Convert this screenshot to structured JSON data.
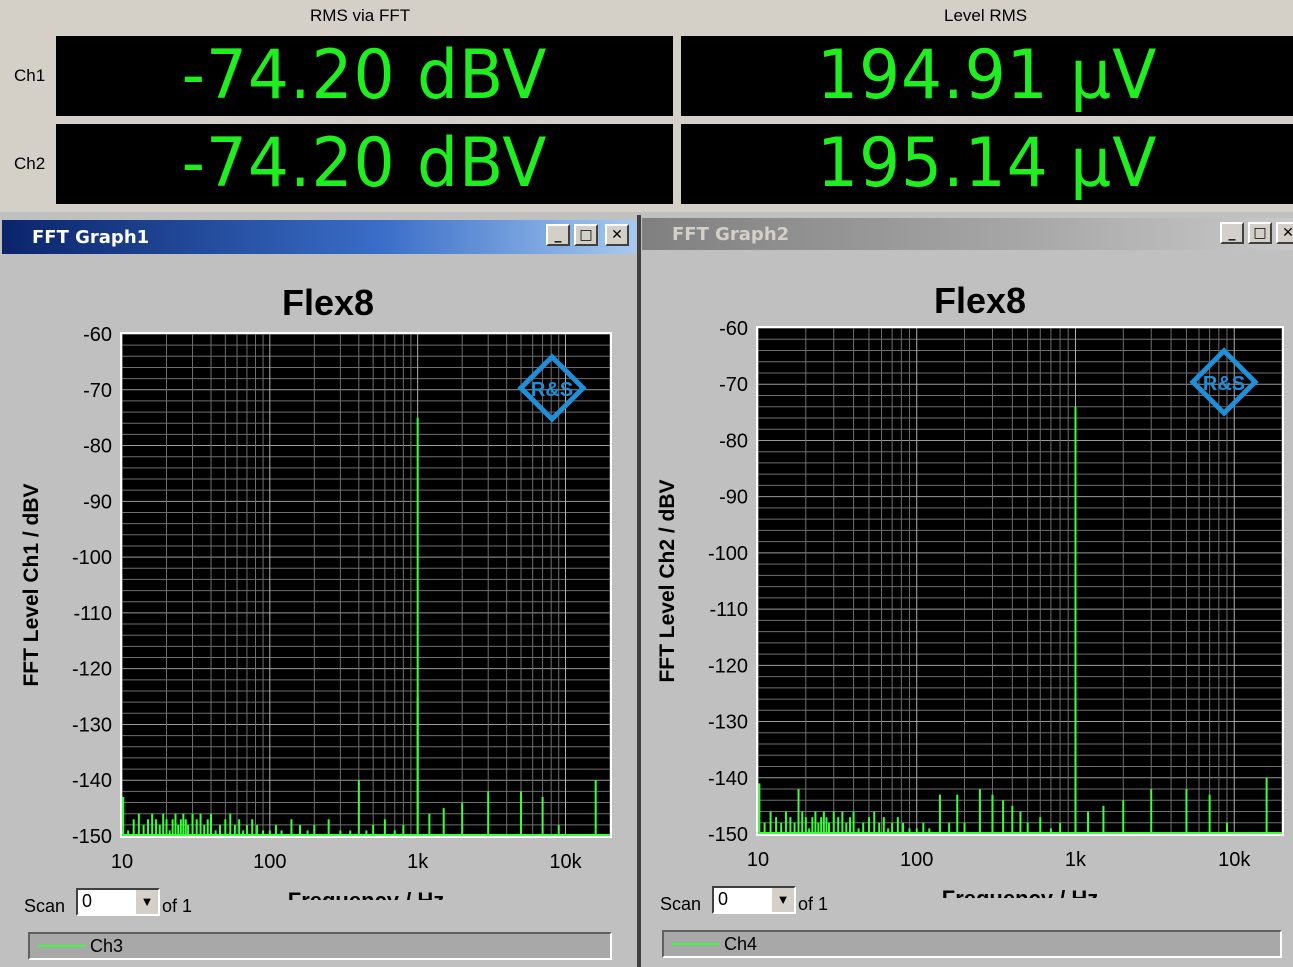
{
  "display": {
    "col1_header": "RMS via FFT",
    "col2_header": "Level RMS",
    "rows": [
      {
        "channel": "Ch1",
        "rms_fft": "-74.20 dBV",
        "level_rms": "194.91 µV"
      },
      {
        "channel": "Ch2",
        "rms_fft": "-74.20 dBV",
        "level_rms": "195.14 µV"
      }
    ],
    "value_color": "#1fef1f"
  },
  "windows": [
    {
      "title": "FFT Graph1",
      "active": true,
      "plot_title": "Flex8",
      "ylabel": "FFT Level Ch1 / dBV",
      "xlabel": "Frequency / Hz",
      "scan_label": "Scan",
      "scan_value": "0",
      "scan_of": "of 1",
      "legend": "Ch3",
      "logo": "R&S"
    },
    {
      "title": "FFT Graph2",
      "active": false,
      "plot_title": "Flex8",
      "ylabel": "FFT Level Ch2 / dBV",
      "xlabel": "Frequency / Hz",
      "scan_label": "Scan",
      "scan_value": "0",
      "scan_of": "of 1",
      "legend": "Ch4",
      "logo": "R&S"
    }
  ],
  "chart_data": [
    {
      "type": "line",
      "title": "Flex8",
      "xlabel": "Frequency / Hz",
      "ylabel": "FFT Level Ch1 / dBV",
      "x_scale": "log",
      "xlim": [
        10,
        20000
      ],
      "ylim": [
        -150,
        -60
      ],
      "x_ticks": [
        "10",
        "100",
        "1k",
        "10k"
      ],
      "y_ticks": [
        "-60",
        "-70",
        "-80",
        "-90",
        "-100",
        "-110",
        "-120",
        "-130",
        "-140",
        "-150"
      ],
      "grid": true,
      "series": [
        {
          "name": "Ch3",
          "color": "#3cff3c",
          "x": [
            10.2,
            11,
            12,
            13,
            14,
            15,
            16,
            17,
            18,
            19,
            20,
            21,
            22,
            23,
            24,
            25,
            26,
            27,
            28,
            30,
            32,
            34,
            36,
            38,
            40,
            43,
            46,
            50,
            54,
            58,
            62,
            66,
            70,
            76,
            82,
            90,
            100,
            110,
            120,
            140,
            160,
            180,
            200,
            250,
            300,
            350,
            400,
            450,
            500,
            600,
            700,
            800,
            1000,
            1000,
            1000,
            1200,
            1500,
            2000,
            3000,
            5000,
            7000,
            9000,
            16000
          ],
          "y": [
            -143,
            -149,
            -147,
            -146,
            -148,
            -147,
            -146,
            -147,
            -148,
            -146,
            -147,
            -149,
            -147,
            -146,
            -148,
            -147,
            -146,
            -147,
            -148,
            -146,
            -147,
            -146,
            -148,
            -147,
            -146,
            -149,
            -148,
            -147,
            -146,
            -148,
            -147,
            -149,
            -148,
            -147,
            -148,
            -149,
            -149,
            -148,
            -149,
            -147,
            -148,
            -149,
            -148,
            -147,
            -149,
            -149,
            -140,
            -149,
            -148,
            -147,
            -149,
            -148,
            -150,
            -75,
            -125,
            -146,
            -145,
            -144,
            -142,
            -142,
            -143,
            -148,
            -140
          ]
        }
      ]
    },
    {
      "type": "line",
      "title": "Flex8",
      "xlabel": "Frequency / Hz",
      "ylabel": "FFT Level Ch2 / dBV",
      "x_scale": "log",
      "xlim": [
        10,
        20000
      ],
      "ylim": [
        -150,
        -60
      ],
      "x_ticks": [
        "10",
        "100",
        "1k",
        "10k"
      ],
      "y_ticks": [
        "-60",
        "-70",
        "-80",
        "-90",
        "-100",
        "-110",
        "-120",
        "-130",
        "-140",
        "-150"
      ],
      "grid": true,
      "series": [
        {
          "name": "Ch4",
          "color": "#3cff3c",
          "x": [
            10.2,
            11,
            12,
            13,
            14,
            15,
            16,
            17,
            18,
            19,
            20,
            21,
            22,
            23,
            24,
            25,
            26,
            27,
            28,
            30,
            32,
            34,
            36,
            38,
            40,
            43,
            46,
            50,
            54,
            58,
            62,
            66,
            70,
            76,
            82,
            90,
            100,
            110,
            120,
            140,
            160,
            180,
            200,
            250,
            300,
            350,
            400,
            450,
            500,
            600,
            700,
            800,
            1000,
            1000,
            1000,
            1200,
            1500,
            2000,
            3000,
            5000,
            7000,
            9000,
            16000
          ],
          "y": [
            -141,
            -148,
            -146,
            -147,
            -148,
            -146,
            -147,
            -148,
            -142,
            -146,
            -147,
            -149,
            -147,
            -146,
            -148,
            -147,
            -146,
            -147,
            -148,
            -146,
            -147,
            -146,
            -148,
            -147,
            -146,
            -149,
            -148,
            -147,
            -146,
            -148,
            -147,
            -149,
            -148,
            -147,
            -148,
            -149,
            -149,
            -148,
            -149,
            -143,
            -148,
            -143,
            -148,
            -142,
            -143,
            -144,
            -145,
            -146,
            -148,
            -147,
            -149,
            -148,
            -150,
            -74,
            -126,
            -146,
            -145,
            -144,
            -142,
            -142,
            -143,
            -148,
            -140
          ]
        }
      ]
    }
  ]
}
